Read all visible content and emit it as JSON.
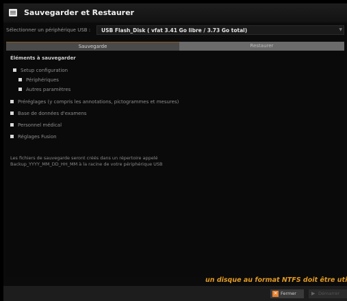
{
  "title": "Sauvegarder et Restaurer",
  "device": {
    "label": "Sélectionner un périphérique USB :",
    "value": "USB Flash_Disk ( vfat 3.41 Go libre / 3.73 Go total)"
  },
  "tabs": [
    {
      "label": "Sauvegarde",
      "active": true
    },
    {
      "label": "Restaurer",
      "active": false
    }
  ],
  "section_title": "Éléments à sauvegarder",
  "items": [
    {
      "label": "Setup configuration",
      "checked": true
    },
    {
      "label": "Périphériques",
      "checked": true
    },
    {
      "label": "Autres paramètres",
      "checked": true
    },
    {
      "label": "Préréglages (y compris les annotations, pictogrammes et mesures)",
      "checked": true
    },
    {
      "label": "Base de données d'examens",
      "checked": true
    },
    {
      "label": "Personnel médical",
      "checked": true
    },
    {
      "label": "Réglages Fusion",
      "checked": true
    }
  ],
  "note": {
    "line1": "Les fichiers de sauvegarde seront créés dans un répertoire appelé",
    "line2": "Backup_YYYY_MM_DD_HH_MM à la racine de votre périphérique USB"
  },
  "warning": "un disque au format NTFS doit être utilisé",
  "buttons": {
    "close": "Fermer",
    "start": "Démarrer"
  },
  "colors": {
    "accent": "#e29a22",
    "close_icon": "#e8812d"
  }
}
